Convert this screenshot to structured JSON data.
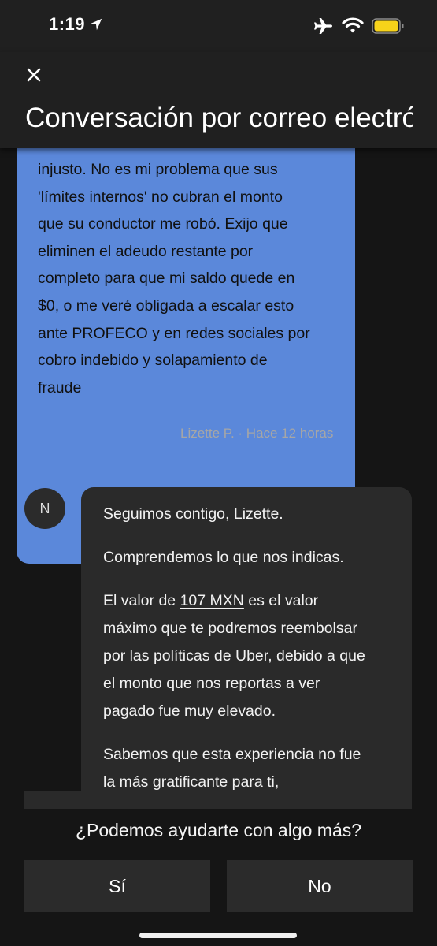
{
  "status_bar": {
    "time": "1:19",
    "icons": [
      "location-arrow-icon",
      "airplane-icon",
      "wifi-icon",
      "battery-icon"
    ],
    "battery_color": "#f7d31a"
  },
  "header": {
    "close_icon": "close-icon",
    "title": "Conversación por correo electrónico"
  },
  "thread": {
    "user_message": {
      "lines": [
        "injusto. No es mi problema que sus",
        "'límites internos' no cubran el monto",
        "que su conductor me robó. Exijo que",
        "eliminen el adeudo restante por",
        "completo para que mi saldo quede en",
        "$0, o me veré obligada a escalar esto",
        "ante PROFECO y en redes sociales por",
        "cobro indebido y solapamiento de",
        "fraude"
      ],
      "bubble_color": "#5b88da",
      "meta": "Lizette P. · Hace 12 horas"
    },
    "agent_message": {
      "avatar_letter": "N",
      "paragraph_1": "Seguimos contigo, Lizette.",
      "paragraph_2": "Comprendemos lo que nos indicas.",
      "paragraph_3": {
        "prefix": "El valor de ",
        "link": "107 MXN",
        "line_1_suffix": " es el valor",
        "lines": [
          "máximo que te podremos reembolsar",
          "por las políticas de Uber, debido a que",
          "el monto que nos reportas a ver",
          "pagado fue muy elevado."
        ]
      },
      "paragraph_4": {
        "lines": [
          "Sabemos que esta experiencia no fue",
          "la más gratificante para ti,"
        ]
      }
    }
  },
  "footer": {
    "question": "¿Podemos ayudarte con algo más?",
    "yes_label": "Sí",
    "no_label": "No"
  }
}
